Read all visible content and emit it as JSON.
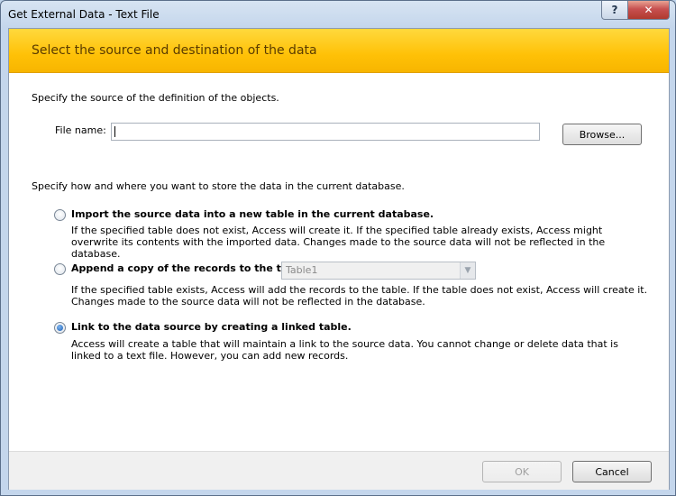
{
  "window": {
    "title": "Get External Data - Text File",
    "help_glyph": "?",
    "close_glyph": "✕"
  },
  "banner": {
    "title": "Select the source and destination of the data"
  },
  "source": {
    "instruction": "Specify the source of the definition of the objects.",
    "file_name_label": "File name:",
    "file_name_value": "",
    "browse_label": "Browse..."
  },
  "storage": {
    "instruction": "Specify how and where you want to store the data in the current database.",
    "options": [
      {
        "label": "Import the source data into a new table in the current database.",
        "description": "If the specified table does not exist, Access will create it. If the specified table already exists, Access might overwrite its contents with the imported data. Changes made to the source data will not be reflected in the database.",
        "selected": false
      },
      {
        "label": "Append a copy of the records to the table:",
        "description": "If the specified table exists, Access will add the records to the table. If the table does not exist, Access will create it. Changes made to the source data will not be reflected in the database.",
        "selected": false,
        "table_value": "Table1"
      },
      {
        "label": "Link to the data source by creating a linked table.",
        "description": "Access will create a table that will maintain a link to the source data. You cannot change or delete data that is linked to a text file. However, you can add new records.",
        "selected": true
      }
    ]
  },
  "footer": {
    "ok_label": "OK",
    "cancel_label": "Cancel"
  }
}
